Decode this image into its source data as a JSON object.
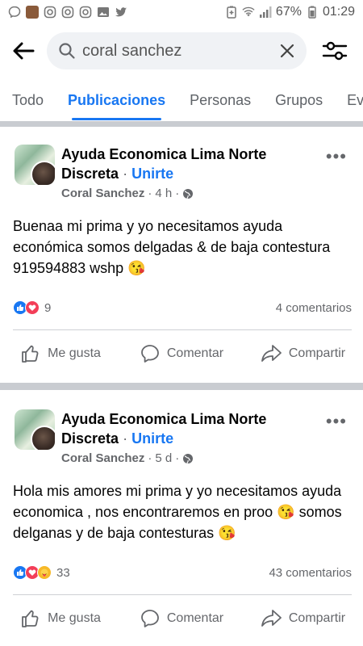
{
  "status_bar": {
    "battery": "67%",
    "time": "01:29"
  },
  "search": {
    "query": "coral sanchez"
  },
  "tabs": [
    {
      "label": "Todo"
    },
    {
      "label": "Publicaciones"
    },
    {
      "label": "Personas"
    },
    {
      "label": "Grupos"
    },
    {
      "label": "Ev"
    }
  ],
  "posts": [
    {
      "group_line1": "Ayuda Economica Lima Norte",
      "group_line2": "Discreta",
      "join_label": "Unirte",
      "author": "Coral Sanchez",
      "time": "4 h",
      "text": "Buenaa mi prima y yo necesitamos ayuda económica somos delgadas & de baja contestura 919594883 wshp 😘",
      "reaction_count": "9",
      "comments": "4 comentarios"
    },
    {
      "group_line1": "Ayuda Economica Lima Norte",
      "group_line2": "Discreta",
      "join_label": "Unirte",
      "author": "Coral Sanchez",
      "time": "5 d",
      "text": "Hola mis amores mi prima  y yo necesitamos ayuda economica , nos encontraremos en proo 😘 somos delganas y de baja contesturas 😘",
      "reaction_count": "33",
      "comments": "43 comentarios"
    }
  ],
  "actions": {
    "like": "Me gusta",
    "comment": "Comentar",
    "share": "Compartir"
  }
}
